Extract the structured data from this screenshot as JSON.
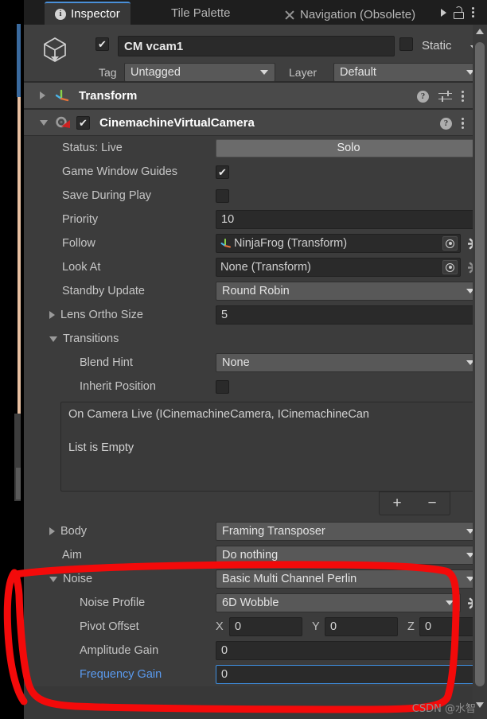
{
  "window": {
    "tabs": [
      {
        "label": "Inspector",
        "icon": "info-icon",
        "active": true
      },
      {
        "label": "Tile Palette",
        "icon": "",
        "active": false
      },
      {
        "label": "Navigation (Obsolete)",
        "icon": "navigation-icon",
        "active": false
      }
    ],
    "controls": {
      "more_tabs": "play-arrow-icon",
      "lock": "lock-icon",
      "menu": "kebab-menu-icon"
    }
  },
  "object_header": {
    "icon": "gameobject-cube-icon",
    "enabled": true,
    "name": "CM vcam1",
    "static_label": "Static",
    "static_checked": false,
    "tag_label": "Tag",
    "tag_value": "Untagged",
    "layer_label": "Layer",
    "layer_value": "Default"
  },
  "components": [
    {
      "name": "Transform",
      "icon": "transform-axis-icon",
      "expanded": false,
      "has_checkbox": false,
      "icons": [
        "help-icon",
        "preset-icon",
        "kebab-menu-icon"
      ]
    },
    {
      "name": "CinemachineVirtualCamera",
      "icon": "cinemachine-icon",
      "expanded": true,
      "has_checkbox": true,
      "checked": true,
      "icons": [
        "help-icon",
        "kebab-menu-icon"
      ]
    }
  ],
  "vcam": {
    "status_label": "Status: Live",
    "solo_button": "Solo",
    "game_window_guides_label": "Game Window Guides",
    "game_window_guides_checked": true,
    "save_during_play_label": "Save During Play",
    "save_during_play_checked": false,
    "priority_label": "Priority",
    "priority_value": "10",
    "follow_label": "Follow",
    "follow_value": "NinjaFrog (Transform)",
    "look_at_label": "Look At",
    "look_at_value": "None (Transform)",
    "standby_update_label": "Standby Update",
    "standby_update_value": "Round Robin",
    "lens_ortho_size_label": "Lens Ortho Size",
    "lens_ortho_size_value": "5",
    "transitions_label": "Transitions",
    "blend_hint_label": "Blend Hint",
    "blend_hint_value": "None",
    "inherit_position_label": "Inherit Position",
    "inherit_position_checked": false,
    "event_title": "On Camera Live (ICinemachineCamera, ICinemachineCan",
    "event_empty": "List is Empty",
    "add_button": "+",
    "remove_button": "−",
    "body_label": "Body",
    "body_value": "Framing Transposer",
    "aim_label": "Aim",
    "aim_value": "Do nothing",
    "noise_label": "Noise",
    "noise_value": "Basic Multi Channel Perlin",
    "noise_profile_label": "Noise Profile",
    "noise_profile_value": "6D Wobble",
    "pivot_offset_label": "Pivot Offset",
    "pivot_x_label": "X",
    "pivot_x_value": "0",
    "pivot_y_label": "Y",
    "pivot_y_value": "0",
    "pivot_z_label": "Z",
    "pivot_z_value": "0",
    "amplitude_gain_label": "Amplitude Gain",
    "amplitude_gain_value": "0",
    "frequency_gain_label": "Frequency Gain",
    "frequency_gain_value": "0"
  },
  "annotation": {
    "color": "#ff0000",
    "shape": "hand-drawn-rectangle-highlight"
  },
  "watermark": "CSDN @水智",
  "colors": {
    "accent_tab": "#4a90d9",
    "focus_border": "#3f8fe0",
    "focus_label": "#5a9bf0",
    "panel_bg": "#3c3c3c",
    "header_bg": "#4a4a4a",
    "annotation_red": "#ff0000"
  }
}
